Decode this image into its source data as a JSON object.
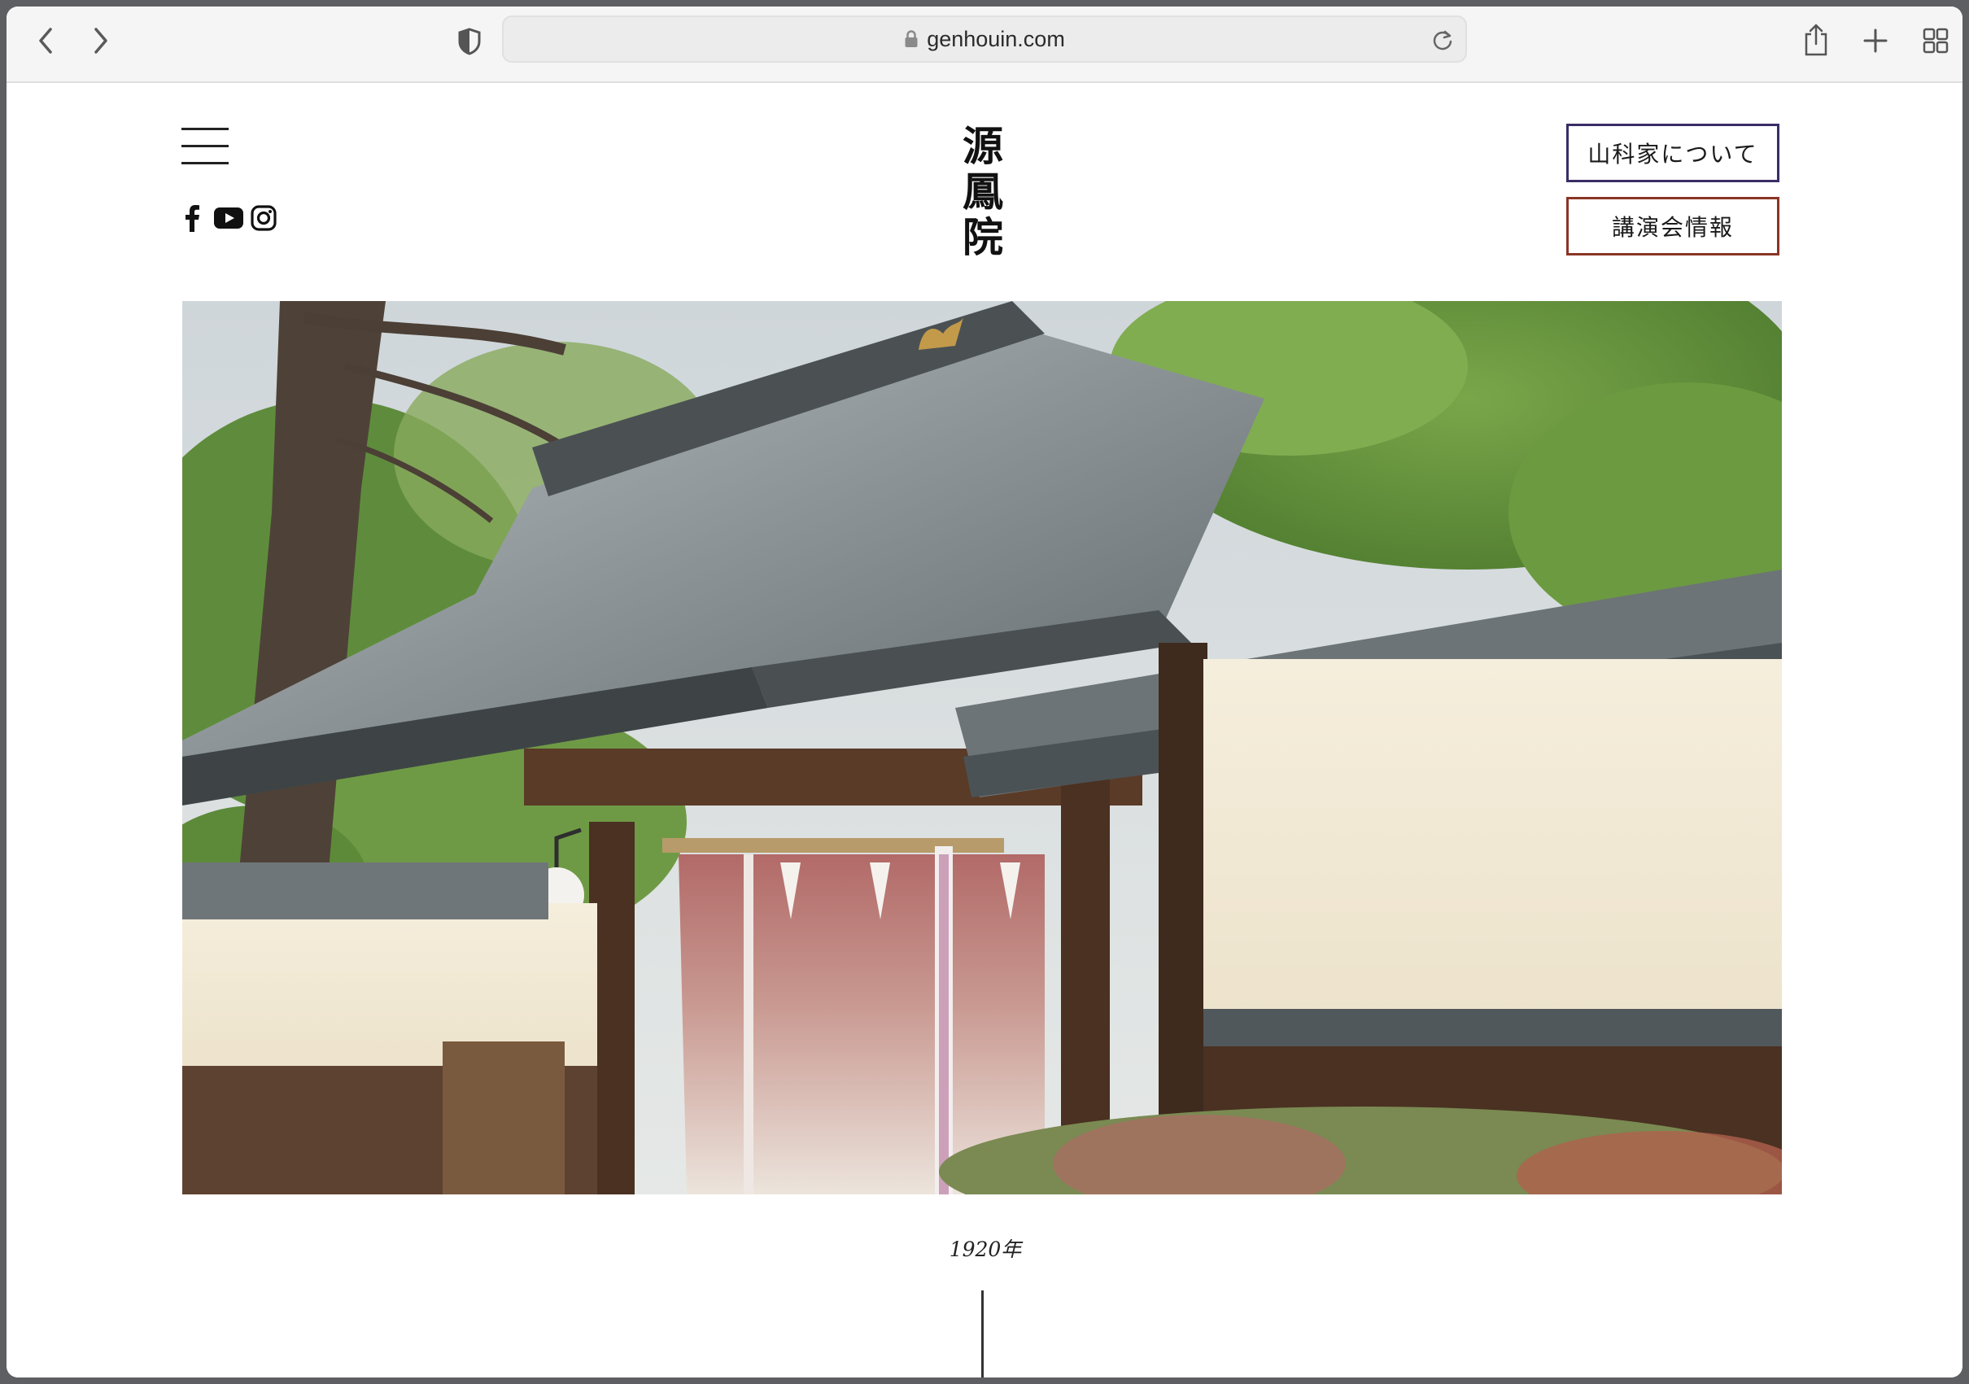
{
  "browser": {
    "url": "genhouin.com",
    "icons": {
      "back": "chevron-left-icon",
      "forward": "chevron-right-icon",
      "privacy": "shield-icon",
      "lock": "lock-icon",
      "reload": "reload-icon",
      "share": "share-icon",
      "new_tab": "plus-icon",
      "tabs": "grid-icon"
    }
  },
  "header": {
    "logo_chars": [
      "源",
      "鳳",
      "院"
    ],
    "social": [
      "facebook-icon",
      "youtube-icon",
      "instagram-icon"
    ],
    "buttons": {
      "about": "山科家について",
      "lecture": "講演会情報"
    },
    "colors": {
      "about_border": "#3a2d66",
      "lecture_border": "#8a3525"
    }
  },
  "hero": {
    "subject": "temple gate with tiled roof and noren curtain"
  },
  "timeline": {
    "year": "1920年"
  }
}
